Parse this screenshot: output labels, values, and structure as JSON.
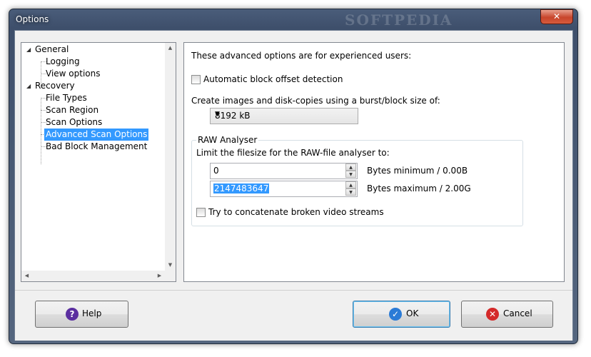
{
  "window": {
    "title": "Options",
    "watermark": "SOFTPEDIA",
    "close_glyph": "✕"
  },
  "tree": {
    "items": [
      {
        "label": "General",
        "level": 0,
        "expander": "◢"
      },
      {
        "label": "Logging",
        "level": 1
      },
      {
        "label": "View options",
        "level": 1
      },
      {
        "label": "Recovery",
        "level": 0,
        "expander": "◢"
      },
      {
        "label": "File Types",
        "level": 1
      },
      {
        "label": "Scan Region",
        "level": 1
      },
      {
        "label": "Scan Options",
        "level": 1
      },
      {
        "label": "Advanced Scan Options",
        "level": 1,
        "selected": true
      },
      {
        "label": "Bad Block Management",
        "level": 1
      }
    ]
  },
  "panel": {
    "intro": "These advanced options are for experienced users:",
    "auto_block_label": "Automatic block offset detection",
    "auto_block_checked": false,
    "burst_label": "Create images and disk-copies using a burst/block size of:",
    "burst_value": "8192 kB",
    "raw": {
      "legend": "RAW Analyser",
      "limit_label": "Limit the filesize for the RAW-file analyser to:",
      "min_value": "0",
      "min_label": "Bytes minimum / 0.00B",
      "max_value": "2147483647",
      "max_label": "Bytes maximum / 2.00G",
      "concat_label": "Try to concatenate broken video streams",
      "concat_checked": false
    }
  },
  "buttons": {
    "help": "Help",
    "ok": "OK",
    "cancel": "Cancel"
  },
  "icons": {
    "help": "?",
    "ok": "✓",
    "cancel": "✕"
  },
  "colors": {
    "selection": "#3399ff",
    "help_icon": "#5b2fa0",
    "ok_icon": "#2b7bd6",
    "cancel_icon": "#d42a2a"
  }
}
